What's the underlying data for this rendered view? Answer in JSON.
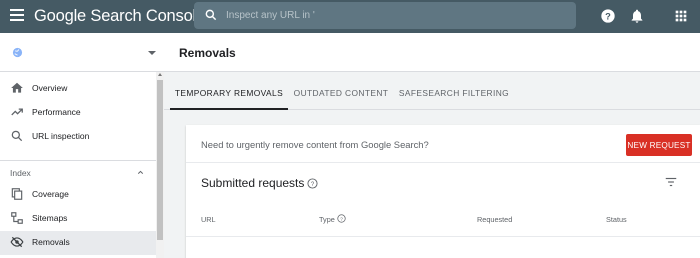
{
  "header": {
    "app_name": "Google Search Console",
    "search_placeholder": "Inspect any URL in '"
  },
  "sidebar": {
    "items": [
      {
        "label": "Overview",
        "icon": "home-icon"
      },
      {
        "label": "Performance",
        "icon": "trending-up-icon"
      },
      {
        "label": "URL inspection",
        "icon": "search-icon"
      }
    ],
    "section": {
      "label": "Index"
    },
    "index_items": [
      {
        "label": "Coverage",
        "icon": "coverage-icon"
      },
      {
        "label": "Sitemaps",
        "icon": "sitemap-icon"
      },
      {
        "label": "Removals",
        "icon": "eye-off-icon",
        "active": true
      }
    ]
  },
  "main": {
    "title": "Removals",
    "tabs": [
      {
        "label": "TEMPORARY REMOVALS",
        "active": true
      },
      {
        "label": "OUTDATED CONTENT"
      },
      {
        "label": "SAFESEARCH FILTERING"
      }
    ],
    "prompt": "Need to urgently remove content from Google Search?",
    "new_request_label": "NEW REQUEST",
    "submitted_title": "Submitted requests",
    "columns": [
      "URL",
      "Type",
      "Requested",
      "Status"
    ]
  },
  "colors": {
    "topbar": "#455a64",
    "primary_button": "#d93025",
    "active_item_bg": "#e8eaed"
  }
}
